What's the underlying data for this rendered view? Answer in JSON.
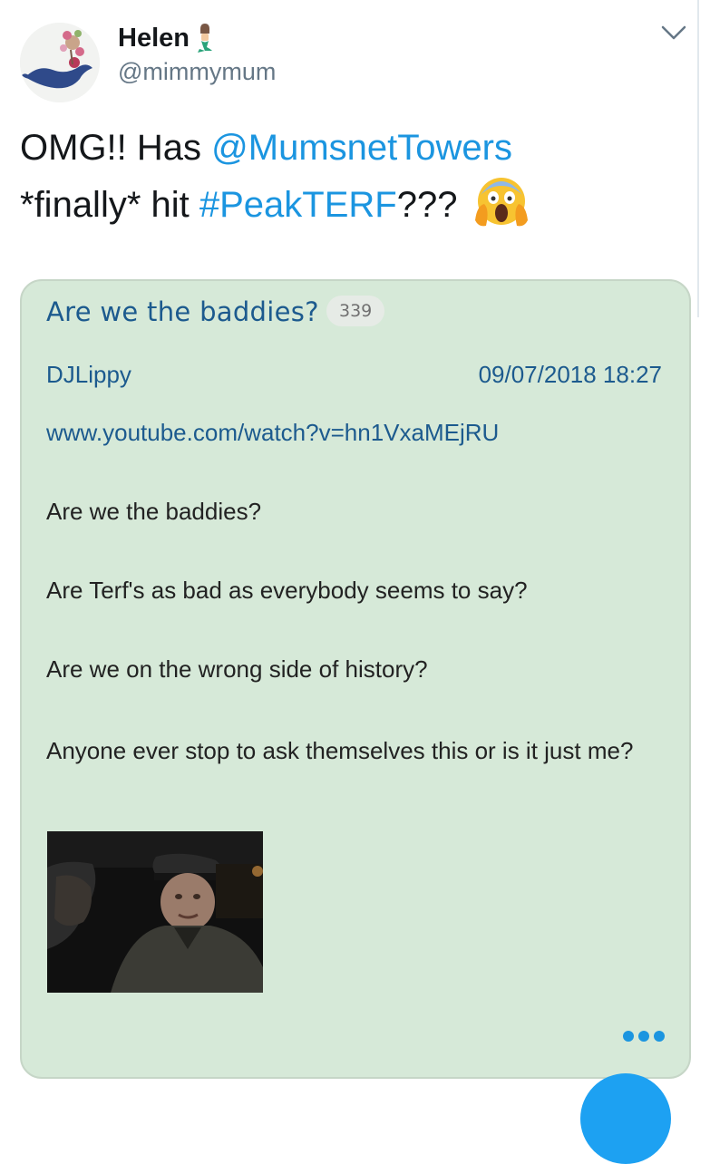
{
  "tweet": {
    "author": {
      "display_name": "Helen",
      "handle": "@mimmymum",
      "name_emoji": "mermaid-emoji"
    },
    "text_parts": {
      "prefix": "OMG!! Has ",
      "mention": "@MumsnetTowers",
      "middle": "*finally* hit ",
      "hashtag": "#PeakTERF",
      "suffix": "???",
      "emoji": "face-screaming-in-fear-emoji"
    }
  },
  "screenshot_card": {
    "thread_title": "Are we the baddies?",
    "reply_count": "339",
    "poster": "DJLippy",
    "timestamp": "09/07/2018 18:27",
    "link": "www.youtube.com/watch?v=hn1VxaMEjRU",
    "lines": [
      "Are we the baddies?",
      "Are Terf's as bad as everybody seems to say?",
      "Are we on the wrong side of history?",
      "Anyone ever stop to ask themselves this or is it just me?"
    ],
    "thumbnail_icon": "video-thumbnail"
  },
  "colors": {
    "link_blue": "#1b95e0",
    "card_bg": "#d6e9d8",
    "card_text_blue": "#1c5a8e",
    "fab_blue": "#1da1f2"
  }
}
